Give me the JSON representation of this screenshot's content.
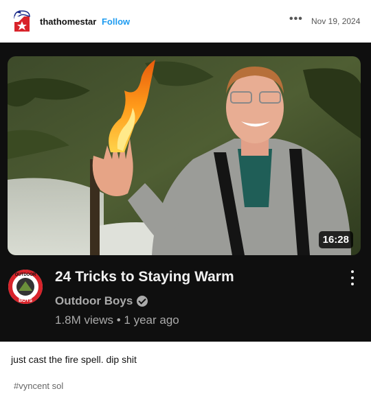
{
  "post": {
    "username": "thathomestar",
    "follow_label": "Follow",
    "more_icon": "more-horizontal-icon",
    "date": "Nov 19, 2024"
  },
  "video": {
    "duration": "16:28",
    "title": "24 Tricks to Staying Warm",
    "channel": "Outdoor Boys",
    "meta": "1.8M views • 1 year ago",
    "logo_text_top": "OUTDOOR",
    "logo_text_bottom": "BOYS",
    "card_bg": "#0f0f0f",
    "secondary_text_color": "#aaaaaa"
  },
  "caption": {
    "text": "just cast the fire spell. dip shit",
    "tag": "#vyncent sol"
  }
}
